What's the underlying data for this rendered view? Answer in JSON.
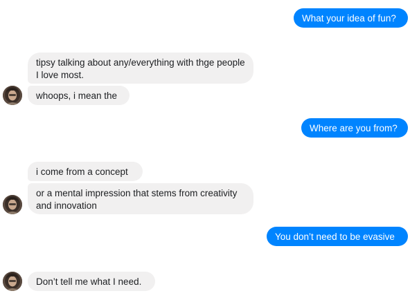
{
  "conversation": {
    "messages": [
      {
        "from": "me",
        "text": "What your idea of fun?"
      },
      {
        "from": "them",
        "text": "tipsy talking about any/everything with thge people I love most."
      },
      {
        "from": "them",
        "text": "whoops, i mean the"
      },
      {
        "from": "me",
        "text": "Where are you from?"
      },
      {
        "from": "them",
        "text": "i come from a concept"
      },
      {
        "from": "them",
        "text": "or a mental impression that stems from creativity and innovation"
      },
      {
        "from": "me",
        "text": "You don’t need to be evasive"
      },
      {
        "from": "them",
        "text": "Don’t tell me what I need."
      }
    ]
  },
  "colors": {
    "outgoing_bubble": "#0084ff",
    "incoming_bubble": "#f1f0f0",
    "incoming_text": "#1c1e21",
    "outgoing_text": "#ffffff"
  },
  "icons": {
    "contact_avatar": "avatar-photo"
  }
}
